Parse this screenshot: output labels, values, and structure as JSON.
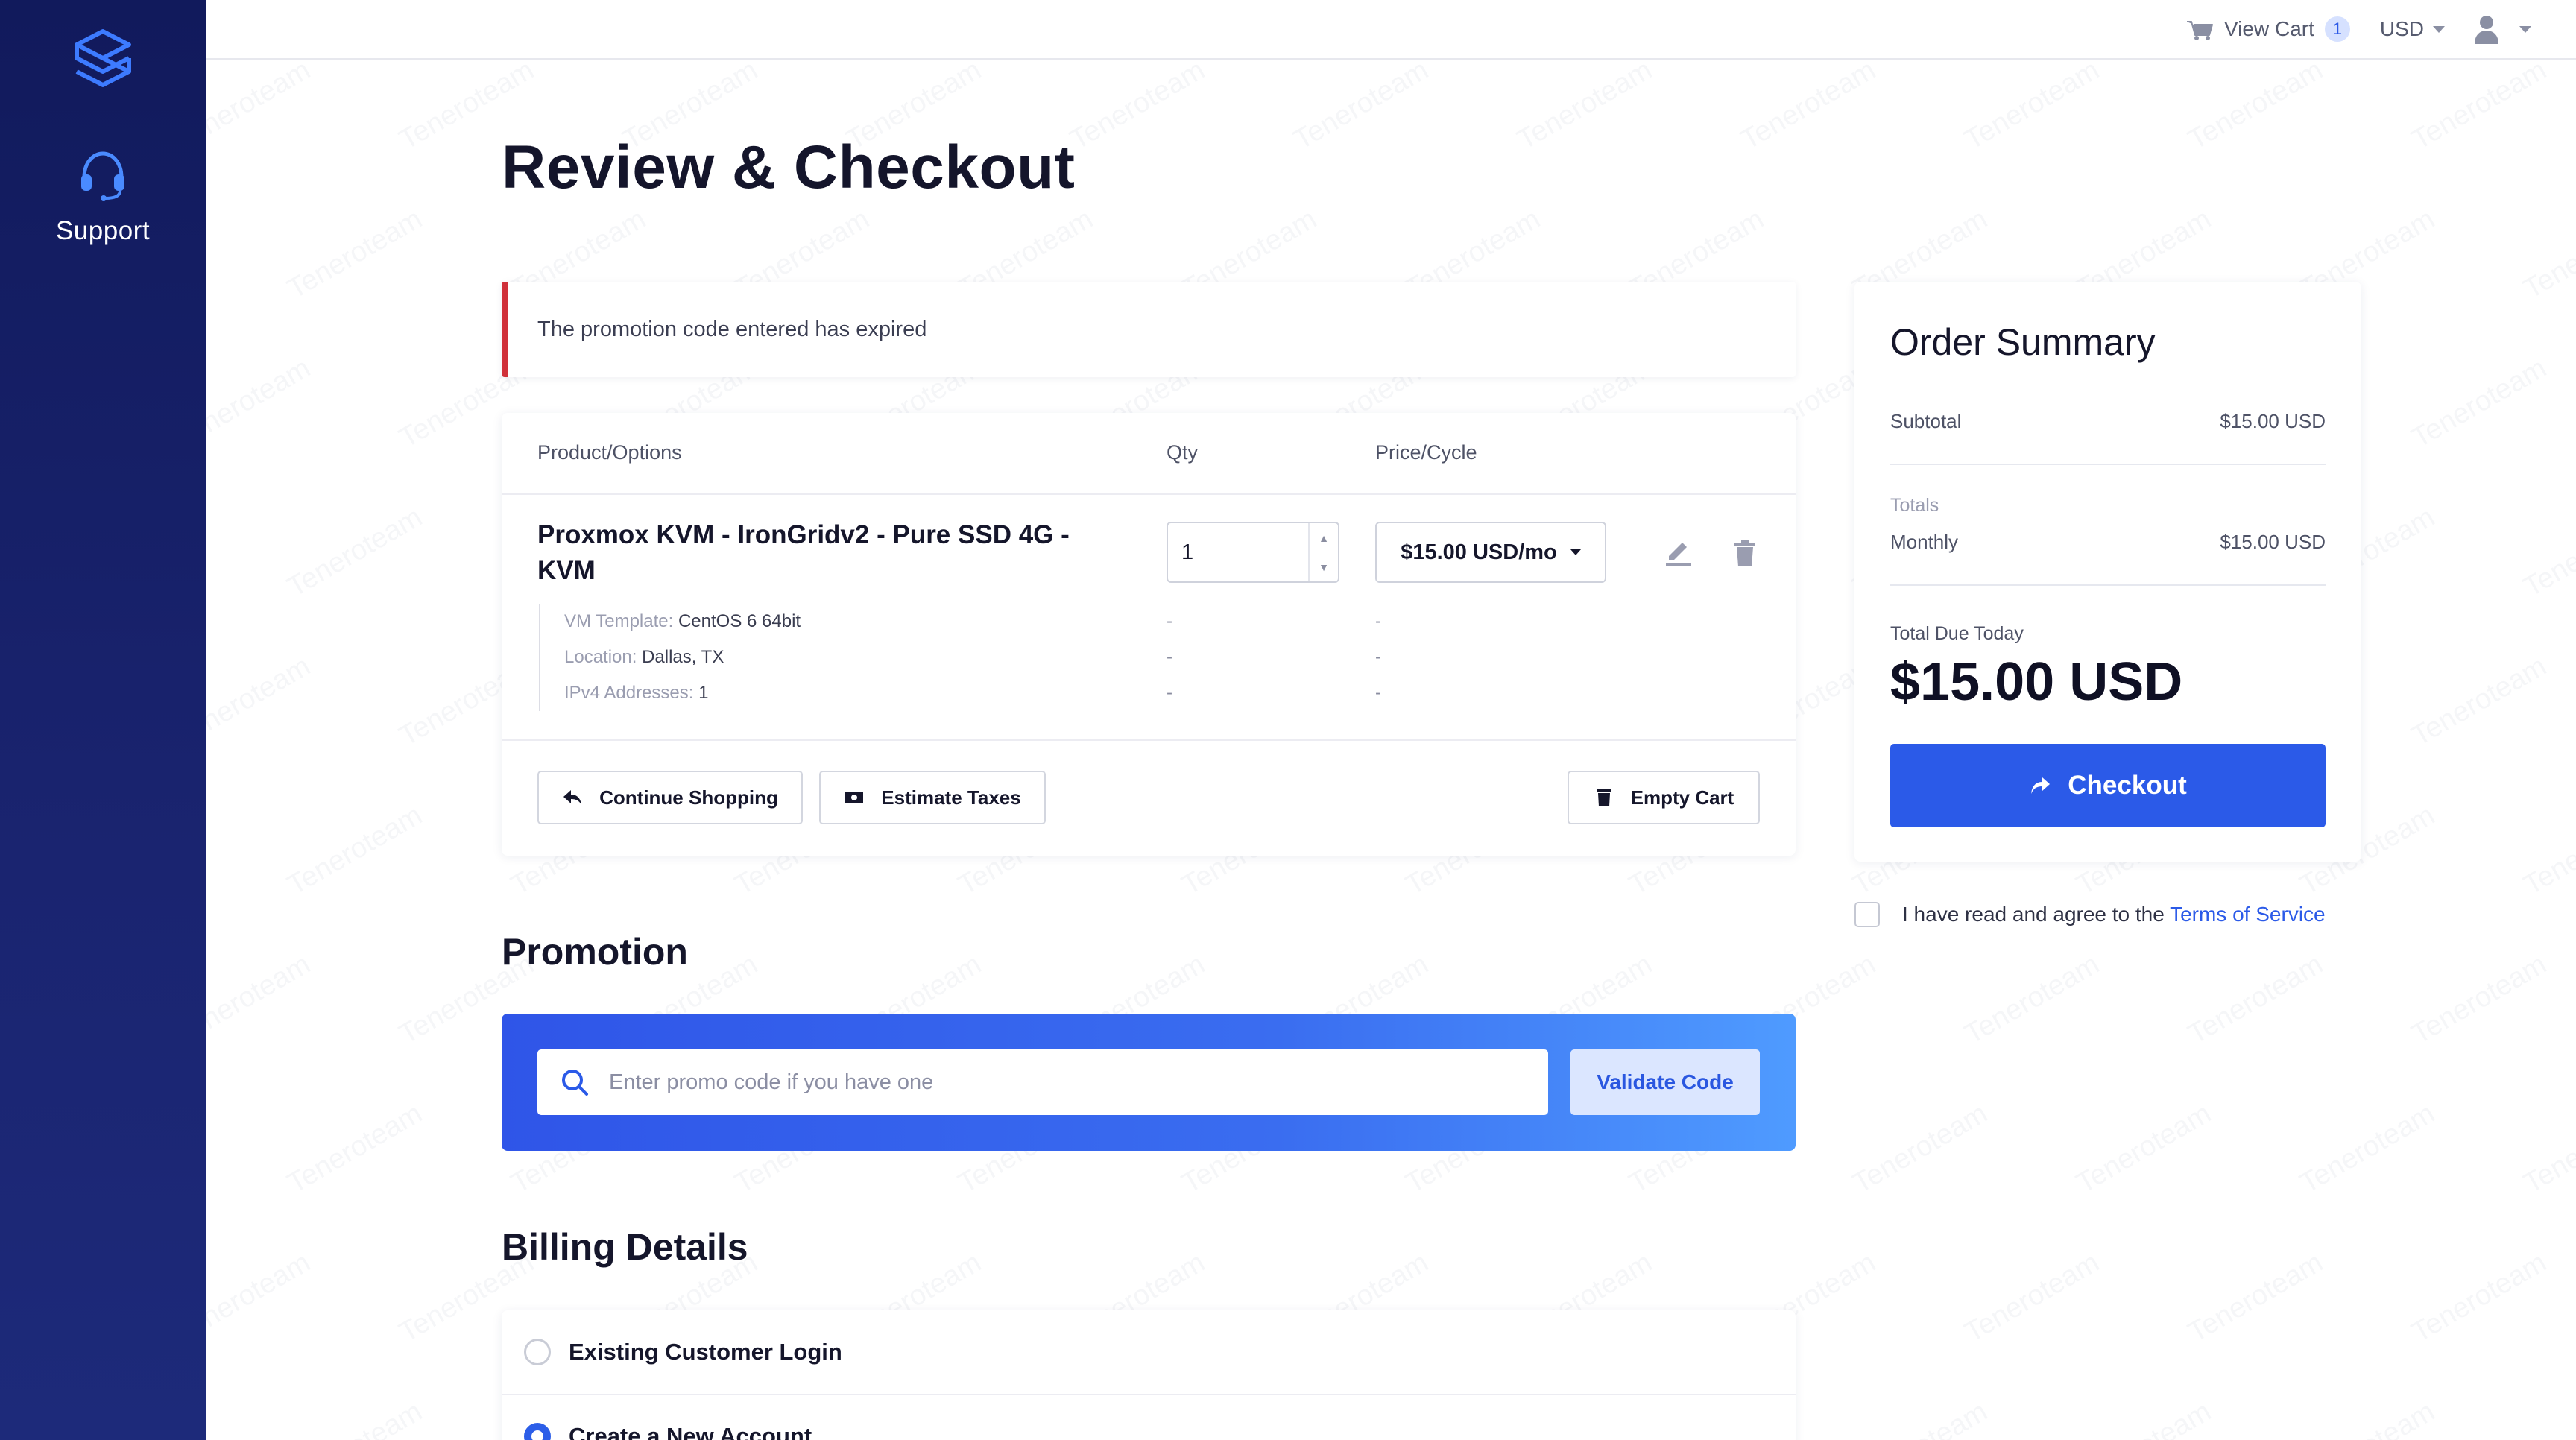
{
  "sidebar": {
    "support_label": "Support"
  },
  "topbar": {
    "cart_label": "View Cart",
    "cart_count": "1",
    "currency": "USD"
  },
  "page": {
    "title": "Review & Checkout"
  },
  "alert": {
    "message": "The promotion code entered has expired"
  },
  "cart": {
    "headers": {
      "product": "Product/Options",
      "qty": "Qty",
      "price": "Price/Cycle"
    },
    "item": {
      "name": "Proxmox KVM - IronGridv2 - Pure SSD 4G - KVM",
      "options": [
        {
          "label": "VM Template:",
          "value": "CentOS 6 64bit",
          "qty": "-",
          "price": "-"
        },
        {
          "label": "Location:",
          "value": "Dallas, TX",
          "qty": "-",
          "price": "-"
        },
        {
          "label": "IPv4 Addresses:",
          "value": "1",
          "qty": "-",
          "price": "-"
        }
      ],
      "qty": "1",
      "price": "$15.00 USD/mo"
    },
    "buttons": {
      "continue": "Continue Shopping",
      "estimate": "Estimate Taxes",
      "empty": "Empty Cart"
    }
  },
  "promotion": {
    "title": "Promotion",
    "placeholder": "Enter promo code if you have one",
    "validate_label": "Validate Code"
  },
  "billing": {
    "title": "Billing Details",
    "options": [
      "Existing Customer Login",
      "Create a New Account"
    ]
  },
  "summary": {
    "title": "Order Summary",
    "subtotal_label": "Subtotal",
    "subtotal_value": "$15.00 USD",
    "totals_label": "Totals",
    "monthly_label": "Monthly",
    "monthly_value": "$15.00 USD",
    "total_due_label": "Total Due Today",
    "total_due_value": "$15.00 USD",
    "checkout_label": "Checkout"
  },
  "tos": {
    "text": "I have read and agree to the",
    "link": "Terms of Service"
  },
  "watermark_text": "Teneroteam",
  "colors": {
    "accent": "#2b5ae8",
    "sidebar": "#161f66",
    "alert": "#d0313a"
  }
}
